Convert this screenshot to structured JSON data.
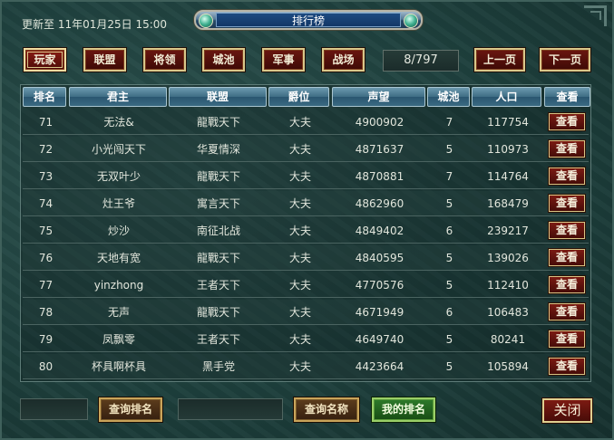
{
  "header": {
    "update_time": "更新至 11年01月25日 15:00",
    "title": "排行榜"
  },
  "tabs": [
    {
      "label": "玩家",
      "active": true
    },
    {
      "label": "联盟",
      "active": false
    },
    {
      "label": "将领",
      "active": false
    },
    {
      "label": "城池",
      "active": false
    },
    {
      "label": "军事",
      "active": false
    },
    {
      "label": "战场",
      "active": false
    }
  ],
  "pagination": {
    "indicator": "8/797",
    "prev_label": "上一页",
    "next_label": "下一页"
  },
  "table": {
    "columns": [
      "排名",
      "君主",
      "联盟",
      "爵位",
      "声望",
      "城池",
      "人口",
      "查看"
    ],
    "view_label": "查看",
    "rows": [
      {
        "rank": "71",
        "lord": "无法&",
        "alliance": "龍戰天下",
        "title": "大夫",
        "prestige": "4900902",
        "cities": "7",
        "population": "117754"
      },
      {
        "rank": "72",
        "lord": "小光闯天下",
        "alliance": "华夏情深",
        "title": "大夫",
        "prestige": "4871637",
        "cities": "5",
        "population": "110973"
      },
      {
        "rank": "73",
        "lord": "无双叶少",
        "alliance": "龍戰天下",
        "title": "大夫",
        "prestige": "4870881",
        "cities": "7",
        "population": "114764"
      },
      {
        "rank": "74",
        "lord": "灶王爷",
        "alliance": "寓言天下",
        "title": "大夫",
        "prestige": "4862960",
        "cities": "5",
        "population": "168479"
      },
      {
        "rank": "75",
        "lord": "炒沙",
        "alliance": "南征北战",
        "title": "大夫",
        "prestige": "4849402",
        "cities": "6",
        "population": "239217"
      },
      {
        "rank": "76",
        "lord": "天地有宽",
        "alliance": "龍戰天下",
        "title": "大夫",
        "prestige": "4840595",
        "cities": "5",
        "population": "139026"
      },
      {
        "rank": "77",
        "lord": "yinzhong",
        "alliance": "王者天下",
        "title": "大夫",
        "prestige": "4770576",
        "cities": "5",
        "population": "112410"
      },
      {
        "rank": "78",
        "lord": "无声",
        "alliance": "龍戰天下",
        "title": "大夫",
        "prestige": "4671949",
        "cities": "6",
        "population": "106483"
      },
      {
        "rank": "79",
        "lord": "凤飘零",
        "alliance": "王者天下",
        "title": "大夫",
        "prestige": "4649740",
        "cities": "5",
        "population": "80241"
      },
      {
        "rank": "80",
        "lord": "杯具啊杯具",
        "alliance": "黑手党",
        "title": "大夫",
        "prestige": "4423664",
        "cities": "5",
        "population": "105894"
      }
    ]
  },
  "footer": {
    "rank_input_value": "",
    "rank_query_label": "查询排名",
    "name_input_value": "",
    "name_query_label": "查询名称",
    "my_rank_label": "我的排名",
    "close_label": "关闭"
  }
}
